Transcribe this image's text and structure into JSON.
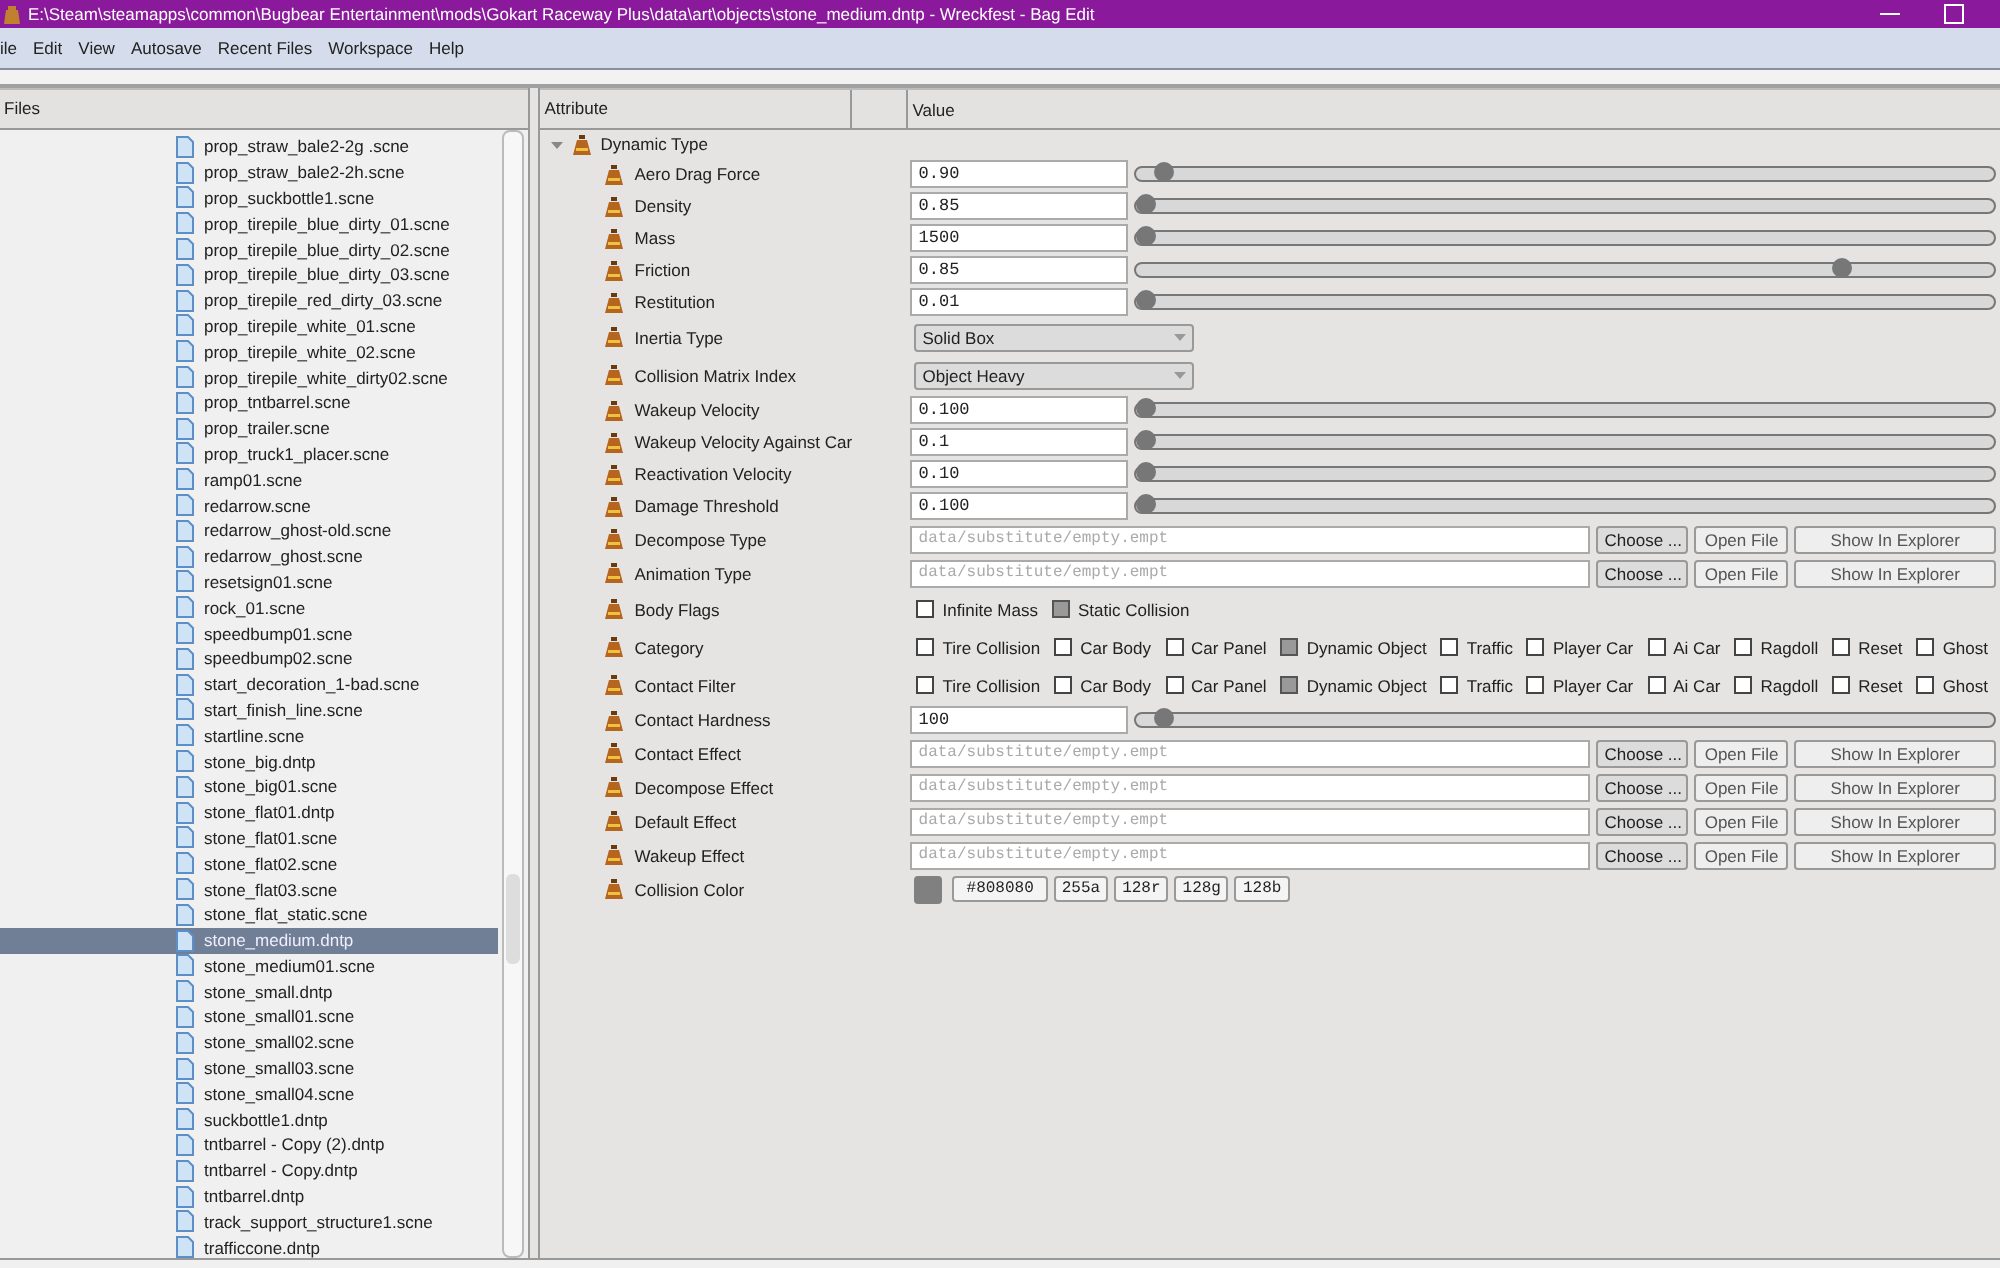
{
  "window": {
    "title": "E:\\Steam\\steamapps\\common\\Bugbear Entertainment\\mods\\Gokart Raceway Plus\\data\\art\\objects\\stone_medium.dntp - Wreckfest - Bag Edit"
  },
  "menu": [
    "ile",
    "Edit",
    "View",
    "Autosave",
    "Recent Files",
    "Workspace",
    "Help"
  ],
  "files": {
    "header": "Files",
    "items": [
      {
        "name": "prop_straw_bale2-2g .scne",
        "selected": false
      },
      {
        "name": "prop_straw_bale2-2h.scne",
        "selected": false
      },
      {
        "name": "prop_suckbottle1.scne",
        "selected": false
      },
      {
        "name": "prop_tirepile_blue_dirty_01.scne",
        "selected": false
      },
      {
        "name": "prop_tirepile_blue_dirty_02.scne",
        "selected": false
      },
      {
        "name": "prop_tirepile_blue_dirty_03.scne",
        "selected": false
      },
      {
        "name": "prop_tirepile_red_dirty_03.scne",
        "selected": false
      },
      {
        "name": "prop_tirepile_white_01.scne",
        "selected": false
      },
      {
        "name": "prop_tirepile_white_02.scne",
        "selected": false
      },
      {
        "name": "prop_tirepile_white_dirty02.scne",
        "selected": false
      },
      {
        "name": "prop_tntbarrel.scne",
        "selected": false
      },
      {
        "name": "prop_trailer.scne",
        "selected": false
      },
      {
        "name": "prop_truck1_placer.scne",
        "selected": false
      },
      {
        "name": "ramp01.scne",
        "selected": false
      },
      {
        "name": "redarrow.scne",
        "selected": false
      },
      {
        "name": "redarrow_ghost-old.scne",
        "selected": false
      },
      {
        "name": "redarrow_ghost.scne",
        "selected": false
      },
      {
        "name": "resetsign01.scne",
        "selected": false
      },
      {
        "name": "rock_01.scne",
        "selected": false
      },
      {
        "name": "speedbump01.scne",
        "selected": false
      },
      {
        "name": "speedbump02.scne",
        "selected": false
      },
      {
        "name": "start_decoration_1-bad.scne",
        "selected": false
      },
      {
        "name": "start_finish_line.scne",
        "selected": false
      },
      {
        "name": "startline.scne",
        "selected": false
      },
      {
        "name": "stone_big.dntp",
        "selected": false
      },
      {
        "name": "stone_big01.scne",
        "selected": false
      },
      {
        "name": "stone_flat01.dntp",
        "selected": false
      },
      {
        "name": "stone_flat01.scne",
        "selected": false
      },
      {
        "name": "stone_flat02.scne",
        "selected": false
      },
      {
        "name": "stone_flat03.scne",
        "selected": false
      },
      {
        "name": "stone_flat_static.scne",
        "selected": false
      },
      {
        "name": "stone_medium.dntp",
        "selected": true
      },
      {
        "name": "stone_medium01.scne",
        "selected": false
      },
      {
        "name": "stone_small.dntp",
        "selected": false
      },
      {
        "name": "stone_small01.scne",
        "selected": false
      },
      {
        "name": "stone_small02.scne",
        "selected": false
      },
      {
        "name": "stone_small03.scne",
        "selected": false
      },
      {
        "name": "stone_small04.scne",
        "selected": false
      },
      {
        "name": "suckbottle1.dntp",
        "selected": false
      },
      {
        "name": "tntbarrel - Copy (2).dntp",
        "selected": false
      },
      {
        "name": "tntbarrel - Copy.dntp",
        "selected": false
      },
      {
        "name": "tntbarrel.dntp",
        "selected": false
      },
      {
        "name": "track_support_structure1.scne",
        "selected": false
      },
      {
        "name": "trafficcone.dntp",
        "selected": false
      }
    ]
  },
  "attributes": {
    "columns": [
      "Attribute",
      "Value"
    ],
    "group": {
      "label": "Dynamic Type",
      "expanded": true
    },
    "rows": [
      {
        "kind": "slider",
        "label": "Aero Drag Force",
        "value": "0.90",
        "level": 0.02
      },
      {
        "kind": "slider",
        "label": "Density",
        "value": "0.85",
        "level": 0
      },
      {
        "kind": "slider",
        "label": "Mass",
        "value": "1500",
        "level": 0
      },
      {
        "kind": "slider",
        "label": "Friction",
        "value": "0.85",
        "level": 0.83
      },
      {
        "kind": "slider",
        "label": "Restitution",
        "value": "0.01",
        "level": 0
      },
      {
        "kind": "combo",
        "label": "Inertia Type",
        "value": "Solid Box"
      },
      {
        "kind": "combo",
        "label": "Collision Matrix Index",
        "value": "Object Heavy"
      },
      {
        "kind": "slider",
        "label": "Wakeup Velocity",
        "value": "0.100",
        "level": 0
      },
      {
        "kind": "slider",
        "label": "Wakeup Velocity Against Car",
        "value": "0.1",
        "level": 0
      },
      {
        "kind": "slider",
        "label": "Reactivation Velocity",
        "value": "0.10",
        "level": 0
      },
      {
        "kind": "slider",
        "label": "Damage Threshold",
        "value": "0.100",
        "level": 0
      },
      {
        "kind": "file",
        "label": "Decompose Type",
        "placeholder": "data/substitute/empty.empt",
        "buttons": [
          "Choose ...",
          "Open File",
          "Show In Explorer"
        ]
      },
      {
        "kind": "file",
        "label": "Animation Type",
        "placeholder": "data/substitute/empty.empt",
        "buttons": [
          "Choose ...",
          "Open File",
          "Show In Explorer"
        ]
      },
      {
        "kind": "flags",
        "label": "Body Flags",
        "flags": [
          {
            "label": "Infinite Mass",
            "checked": false
          },
          {
            "label": "Static Collision",
            "checked": true
          }
        ]
      },
      {
        "kind": "flags",
        "label": "Category",
        "flags": [
          {
            "label": "Tire Collision",
            "checked": false
          },
          {
            "label": "Car Body",
            "checked": false
          },
          {
            "label": "Car Panel",
            "checked": false
          },
          {
            "label": "Dynamic Object",
            "checked": true
          },
          {
            "label": "Traffic",
            "checked": false
          },
          {
            "label": "Player Car",
            "checked": false
          },
          {
            "label": "Ai Car",
            "checked": false
          },
          {
            "label": "Ragdoll",
            "checked": false
          },
          {
            "label": "Reset",
            "checked": false
          },
          {
            "label": "Ghost",
            "checked": false
          }
        ]
      },
      {
        "kind": "flags",
        "label": "Contact Filter",
        "flags": [
          {
            "label": "Tire Collision",
            "checked": false
          },
          {
            "label": "Car Body",
            "checked": false
          },
          {
            "label": "Car Panel",
            "checked": false
          },
          {
            "label": "Dynamic Object",
            "checked": true
          },
          {
            "label": "Traffic",
            "checked": false
          },
          {
            "label": "Player Car",
            "checked": false
          },
          {
            "label": "Ai Car",
            "checked": false
          },
          {
            "label": "Ragdoll",
            "checked": false
          },
          {
            "label": "Reset",
            "checked": false
          },
          {
            "label": "Ghost",
            "checked": false
          }
        ]
      },
      {
        "kind": "slider",
        "label": "Contact Hardness",
        "value": "100",
        "level": 0.02
      },
      {
        "kind": "file",
        "label": "Contact Effect",
        "placeholder": "data/substitute/empty.empt",
        "buttons": [
          "Choose ...",
          "Open File",
          "Show In Explorer"
        ]
      },
      {
        "kind": "file",
        "label": "Decompose Effect",
        "placeholder": "data/substitute/empty.empt",
        "buttons": [
          "Choose ...",
          "Open File",
          "Show In Explorer"
        ]
      },
      {
        "kind": "file",
        "label": "Default Effect",
        "placeholder": "data/substitute/empty.empt",
        "buttons": [
          "Choose ...",
          "Open File",
          "Show In Explorer"
        ]
      },
      {
        "kind": "file",
        "label": "Wakeup Effect",
        "placeholder": "data/substitute/empty.empt",
        "buttons": [
          "Choose ...",
          "Open File",
          "Show In Explorer"
        ]
      },
      {
        "kind": "color",
        "label": "Collision Color",
        "color": "#808080",
        "hex": "#808080",
        "channels": [
          "255a",
          "128r",
          "128g",
          "128b"
        ]
      }
    ]
  }
}
